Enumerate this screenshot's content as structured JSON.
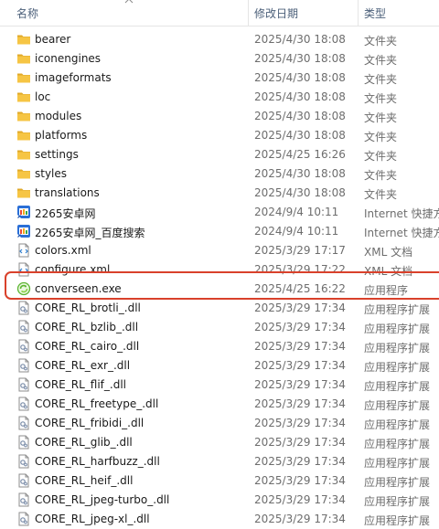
{
  "columns": {
    "name": "名称",
    "date": "修改日期",
    "type": "类型"
  },
  "colors": {
    "folder": "#f6c544",
    "folder_dark": "#e0a92a",
    "highlight": "#d9412b",
    "exe": "#5cb531"
  },
  "files": [
    {
      "name": "bearer",
      "date": "2025/4/30 18:08",
      "type": "文件夹",
      "icon": "folder-icon"
    },
    {
      "name": "iconengines",
      "date": "2025/4/30 18:08",
      "type": "文件夹",
      "icon": "folder-icon"
    },
    {
      "name": "imageformats",
      "date": "2025/4/30 18:08",
      "type": "文件夹",
      "icon": "folder-icon"
    },
    {
      "name": "loc",
      "date": "2025/4/30 18:08",
      "type": "文件夹",
      "icon": "folder-icon"
    },
    {
      "name": "modules",
      "date": "2025/4/30 18:08",
      "type": "文件夹",
      "icon": "folder-icon"
    },
    {
      "name": "platforms",
      "date": "2025/4/30 18:08",
      "type": "文件夹",
      "icon": "folder-icon"
    },
    {
      "name": "settings",
      "date": "2025/4/25 16:26",
      "type": "文件夹",
      "icon": "folder-icon"
    },
    {
      "name": "styles",
      "date": "2025/4/30 18:08",
      "type": "文件夹",
      "icon": "folder-icon"
    },
    {
      "name": "translations",
      "date": "2025/4/30 18:08",
      "type": "文件夹",
      "icon": "folder-icon"
    },
    {
      "name": "2265安卓网",
      "date": "2024/9/4 10:11",
      "type": "Internet 快捷方式",
      "icon": "internet-shortcut-icon"
    },
    {
      "name": "2265安卓网_百度搜索",
      "date": "2024/9/4 10:11",
      "type": "Internet 快捷方式",
      "icon": "internet-shortcut-icon"
    },
    {
      "name": "colors.xml",
      "date": "2025/3/29 17:17",
      "type": "XML 文档",
      "icon": "xml-file-icon"
    },
    {
      "name": "configure.xml",
      "date": "2025/3/29 17:22",
      "type": "XML 文档",
      "icon": "xml-file-icon"
    },
    {
      "name": "converseen.exe",
      "date": "2025/4/25 16:22",
      "type": "应用程序",
      "icon": "exe-icon"
    },
    {
      "name": "CORE_RL_brotli_.dll",
      "date": "2025/3/29 17:34",
      "type": "应用程序扩展",
      "icon": "dll-icon"
    },
    {
      "name": "CORE_RL_bzlib_.dll",
      "date": "2025/3/29 17:34",
      "type": "应用程序扩展",
      "icon": "dll-icon"
    },
    {
      "name": "CORE_RL_cairo_.dll",
      "date": "2025/3/29 17:34",
      "type": "应用程序扩展",
      "icon": "dll-icon"
    },
    {
      "name": "CORE_RL_exr_.dll",
      "date": "2025/3/29 17:34",
      "type": "应用程序扩展",
      "icon": "dll-icon"
    },
    {
      "name": "CORE_RL_flif_.dll",
      "date": "2025/3/29 17:34",
      "type": "应用程序扩展",
      "icon": "dll-icon"
    },
    {
      "name": "CORE_RL_freetype_.dll",
      "date": "2025/3/29 17:34",
      "type": "应用程序扩展",
      "icon": "dll-icon"
    },
    {
      "name": "CORE_RL_fribidi_.dll",
      "date": "2025/3/29 17:34",
      "type": "应用程序扩展",
      "icon": "dll-icon"
    },
    {
      "name": "CORE_RL_glib_.dll",
      "date": "2025/3/29 17:34",
      "type": "应用程序扩展",
      "icon": "dll-icon"
    },
    {
      "name": "CORE_RL_harfbuzz_.dll",
      "date": "2025/3/29 17:34",
      "type": "应用程序扩展",
      "icon": "dll-icon"
    },
    {
      "name": "CORE_RL_heif_.dll",
      "date": "2025/3/29 17:34",
      "type": "应用程序扩展",
      "icon": "dll-icon"
    },
    {
      "name": "CORE_RL_jpeg-turbo_.dll",
      "date": "2025/3/29 17:34",
      "type": "应用程序扩展",
      "icon": "dll-icon"
    },
    {
      "name": "CORE_RL_jpeg-xl_.dll",
      "date": "2025/3/29 17:34",
      "type": "应用程序扩展",
      "icon": "dll-icon"
    }
  ]
}
